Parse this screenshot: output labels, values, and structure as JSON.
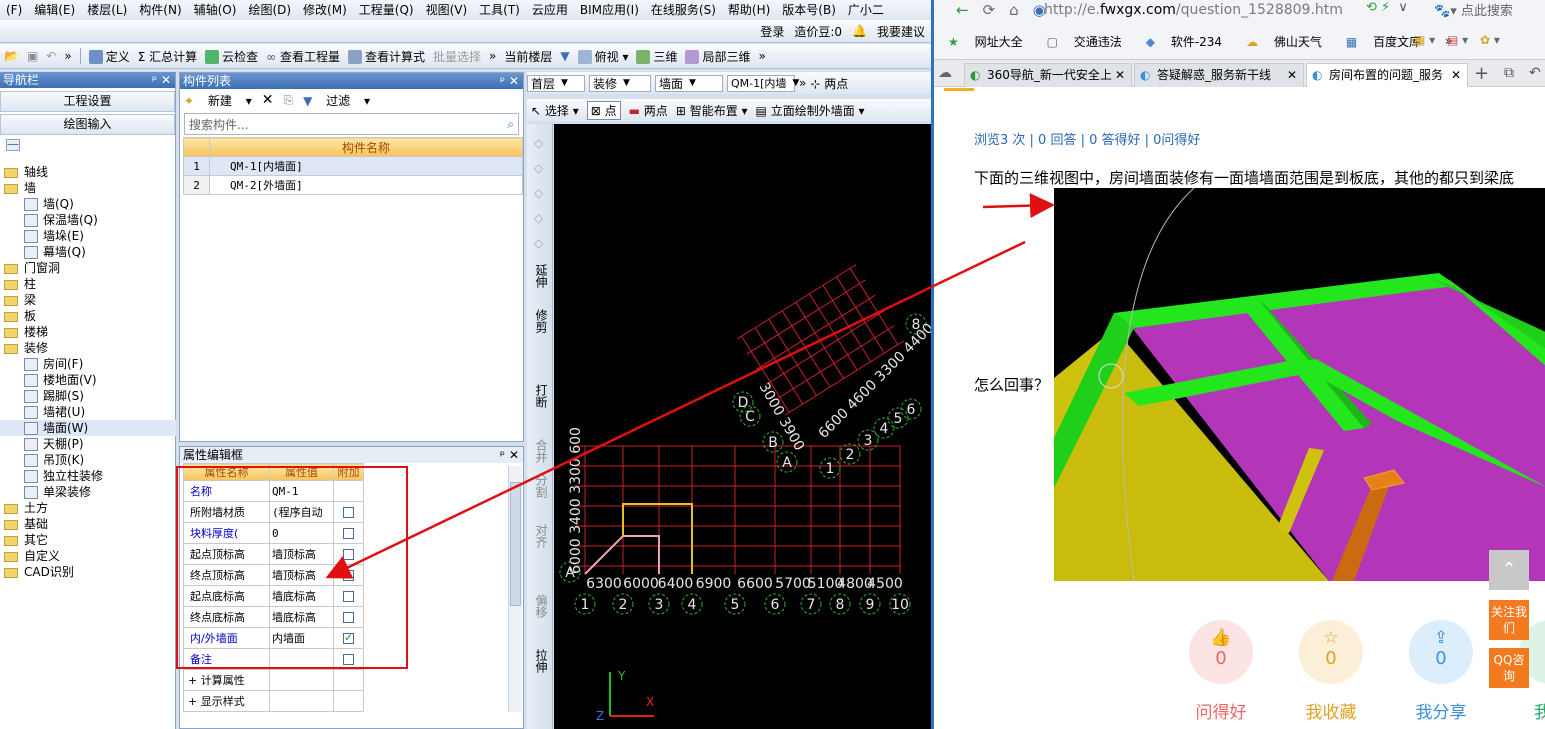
{
  "cad": {
    "menu": [
      "(F)",
      "编辑(E)",
      "楼层(L)",
      "构件(N)",
      "辅轴(O)",
      "绘图(D)",
      "修改(M)",
      "工程量(Q)",
      "视图(V)",
      "工具(T)",
      "云应用",
      "BIM应用(I)",
      "在线服务(S)",
      "帮助(H)",
      "版本号(B)",
      "广小二"
    ],
    "top_right": {
      "login": "登录",
      "cost": "造价豆:0",
      "suggest": "我要建议"
    },
    "toolbar": {
      "define": "定义",
      "sum": "Σ 汇总计算",
      "cloud_check": "云检查",
      "view_qty": "查看工程量",
      "view_formula": "查看计算式",
      "batch": "批量选择",
      "floor": "当前楼层",
      "top_view": "俯视",
      "three_d": "三维",
      "local_3d": "局部三维"
    },
    "nav": {
      "title": "导航栏",
      "btn_project": "工程设置",
      "btn_draw": "绘图输入",
      "tree": [
        {
          "t": "轴线",
          "type": "folder",
          "indent": 0
        },
        {
          "t": "墙",
          "type": "folder",
          "indent": 0
        },
        {
          "t": "墙(Q)",
          "type": "leaf",
          "indent": 1
        },
        {
          "t": "保温墙(Q)",
          "type": "leaf",
          "indent": 1
        },
        {
          "t": "墙垛(E)",
          "type": "leaf",
          "indent": 1
        },
        {
          "t": "幕墙(Q)",
          "type": "leaf",
          "indent": 1
        },
        {
          "t": "门窗洞",
          "type": "folder",
          "indent": 0
        },
        {
          "t": "柱",
          "type": "folder",
          "indent": 0
        },
        {
          "t": "梁",
          "type": "folder",
          "indent": 0
        },
        {
          "t": "板",
          "type": "folder",
          "indent": 0
        },
        {
          "t": "楼梯",
          "type": "folder",
          "indent": 0
        },
        {
          "t": "装修",
          "type": "folder",
          "indent": 0
        },
        {
          "t": "房间(F)",
          "type": "leaf",
          "indent": 1
        },
        {
          "t": "楼地面(V)",
          "type": "leaf",
          "indent": 1
        },
        {
          "t": "踢脚(S)",
          "type": "leaf",
          "indent": 1
        },
        {
          "t": "墙裙(U)",
          "type": "leaf",
          "indent": 1
        },
        {
          "t": "墙面(W)",
          "type": "leaf",
          "indent": 1,
          "selected": true
        },
        {
          "t": "天棚(P)",
          "type": "leaf",
          "indent": 1
        },
        {
          "t": "吊顶(K)",
          "type": "leaf",
          "indent": 1
        },
        {
          "t": "独立柱装修",
          "type": "leaf",
          "indent": 1
        },
        {
          "t": "单梁装修",
          "type": "leaf",
          "indent": 1
        },
        {
          "t": "土方",
          "type": "folder",
          "indent": 0
        },
        {
          "t": "基础",
          "type": "folder",
          "indent": 0
        },
        {
          "t": "其它",
          "type": "folder",
          "indent": 0
        },
        {
          "t": "自定义",
          "type": "folder",
          "indent": 0
        },
        {
          "t": "CAD识别",
          "type": "folder",
          "indent": 0
        }
      ]
    },
    "comp": {
      "title": "构件列表",
      "new": "新建",
      "filter": "过滤",
      "search_placeholder": "搜索构件...",
      "col": "构件名称",
      "rows": [
        {
          "n": "1",
          "name": "QM-1[内墙面]"
        },
        {
          "n": "2",
          "name": "QM-2[外墙面]"
        }
      ]
    },
    "attr": {
      "title": "属性编辑框",
      "h1": "属性名称",
      "h2": "属性值",
      "h3": "附加",
      "rows": [
        {
          "k": "名称",
          "v": "QM-1",
          "blue": true,
          "cb": null
        },
        {
          "k": "所附墙材质",
          "v": "(程序自动",
          "blue": false,
          "cb": false
        },
        {
          "k": "块料厚度(",
          "v": "0",
          "blue": true,
          "cb": false
        },
        {
          "k": "起点顶标高",
          "v": "墙顶标高",
          "blue": false,
          "cb": false
        },
        {
          "k": "终点顶标高",
          "v": "墙顶标高",
          "blue": false,
          "cb": false
        },
        {
          "k": "起点底标高",
          "v": "墙底标高",
          "blue": false,
          "cb": false
        },
        {
          "k": "终点底标高",
          "v": "墙底标高",
          "blue": false,
          "cb": false
        },
        {
          "k": "内/外墙面",
          "v": "内墙面",
          "blue": true,
          "cb": true
        },
        {
          "k": "备注",
          "v": "",
          "blue": true,
          "cb": false
        },
        {
          "k": "+ 计算属性",
          "v": "",
          "blue": false,
          "cb": null
        },
        {
          "k": "+ 显示样式",
          "v": "",
          "blue": false,
          "cb": null
        }
      ]
    },
    "canvasbar": {
      "floor": "首层",
      "type": "装修",
      "comp": "墙面",
      "item": "QM-1[内墙",
      "two_points": "两点"
    },
    "canvasbar2": {
      "select": "选择",
      "point": "点",
      "two_points": "两点",
      "smart": "智能布置",
      "elevation": "立面绘制外墙面"
    },
    "vtools": [
      "延伸",
      "修剪",
      "打断",
      "合并",
      "分割",
      "对齐",
      "偏移",
      "拉伸"
    ],
    "axis_bottom": [
      "6300",
      "6000",
      "6400",
      "6900",
      "6600",
      "5700",
      "5100",
      "4800",
      "4500"
    ],
    "axis_nums": [
      "1",
      "2",
      "3",
      "4",
      "5",
      "6",
      "7",
      "8",
      "9",
      "10"
    ],
    "axis_letters": [
      "A",
      "B",
      "C",
      "D"
    ],
    "rot_nums": [
      "1",
      "2",
      "3",
      "4",
      "5",
      "6",
      "8"
    ],
    "left_dims": "6000 3400 3300 600",
    "rot_dims": "3000 3900",
    "rot_dims2": "6600 4600 3300 4400"
  },
  "browser": {
    "url_prefix": "http://e.",
    "url_domain": "fwxgx.com",
    "url_rest": "/question_1528809.htm",
    "search": "点此搜索",
    "fav": [
      "网址大全",
      "交通违法",
      "软件-234",
      "佛山天气",
      "百度文库"
    ],
    "tabs": [
      "360导航_新一代安全上",
      "答疑解惑_服务新干线",
      "房间布置的问题_服务"
    ],
    "stats": "浏览3 次 | 0 回答 | 0 答得好 | 0问得好",
    "question": "下面的三维视图中，房间墙面装修有一面墙墙面范围是到板底，其他的都只到梁底",
    "why": "怎么回事？",
    "actions": [
      {
        "label": "问得好",
        "count": "0",
        "color": "#f06565"
      },
      {
        "label": "我收藏",
        "count": "0",
        "color": "#e0a224"
      },
      {
        "label": "我分享",
        "count": "0",
        "color": "#3c8fde"
      },
      {
        "label": "我来",
        "count": "",
        "color": "#25a96a"
      }
    ],
    "follow": "关注我们",
    "qq": "QQ咨询"
  },
  "colors": {
    "title_blue": "#3d6fb4",
    "annot_red": "#e01010",
    "cad_red": "#c8202a",
    "cad_white": "#e6e6e6",
    "shot_green": "#23e61c",
    "shot_purple": "#b336b8",
    "shot_yellow": "#cfc20f"
  }
}
